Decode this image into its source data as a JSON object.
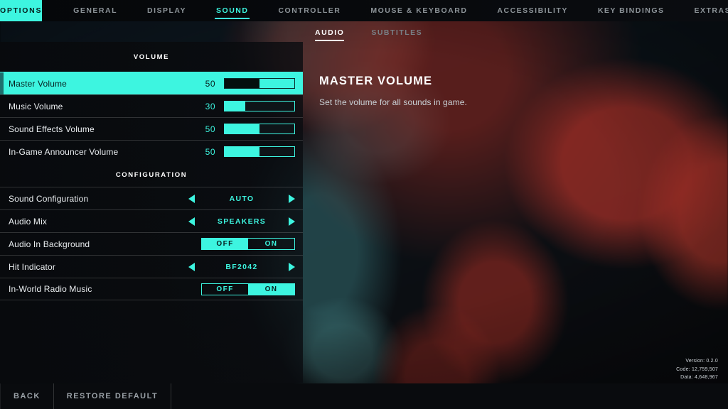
{
  "topnav": {
    "brand": "OPTIONS",
    "tabs": [
      {
        "label": "GENERAL",
        "active": false
      },
      {
        "label": "DISPLAY",
        "active": false
      },
      {
        "label": "SOUND",
        "active": true
      },
      {
        "label": "CONTROLLER",
        "active": false
      },
      {
        "label": "MOUSE & KEYBOARD",
        "active": false
      },
      {
        "label": "ACCESSIBILITY",
        "active": false
      },
      {
        "label": "KEY BINDINGS",
        "active": false
      },
      {
        "label": "EXTRAS",
        "active": false
      }
    ]
  },
  "subnav": {
    "tabs": [
      {
        "label": "AUDIO",
        "active": true
      },
      {
        "label": "SUBTITLES",
        "active": false
      }
    ]
  },
  "settings": {
    "volume_section": {
      "heading": "VOLUME",
      "rows": [
        {
          "label": "Master Volume",
          "value": "50",
          "fill_pct": 50,
          "selected": true
        },
        {
          "label": "Music Volume",
          "value": "30",
          "fill_pct": 30,
          "selected": false
        },
        {
          "label": "Sound Effects Volume",
          "value": "50",
          "fill_pct": 50,
          "selected": false
        },
        {
          "label": "In-Game Announcer Volume",
          "value": "50",
          "fill_pct": 50,
          "selected": false
        }
      ]
    },
    "configuration_section": {
      "heading": "CONFIGURATION",
      "rows": [
        {
          "label": "Sound Configuration",
          "type": "stepper",
          "value": "AUTO"
        },
        {
          "label": "Audio Mix",
          "type": "stepper",
          "value": "SPEAKERS"
        },
        {
          "label": "Audio In Background",
          "type": "toggle",
          "off_label": "OFF",
          "on_label": "ON",
          "selected": "OFF"
        },
        {
          "label": "Hit Indicator",
          "type": "stepper",
          "value": "BF2042"
        },
        {
          "label": "In-World Radio Music",
          "type": "toggle",
          "off_label": "OFF",
          "on_label": "ON",
          "selected": "ON"
        }
      ]
    }
  },
  "detail": {
    "title": "MASTER VOLUME",
    "description": "Set the volume for all sounds in game."
  },
  "version_info": {
    "version": "Version: 0.2.0",
    "code": "Code: 12,759,507",
    "data": "Data: 4,648,967"
  },
  "bottombar": {
    "back": "BACK",
    "restore_default": "RESTORE DEFAULT"
  },
  "colors": {
    "accent": "#3df5e0",
    "panel": "#090b0e",
    "text": "#e9edf0"
  }
}
